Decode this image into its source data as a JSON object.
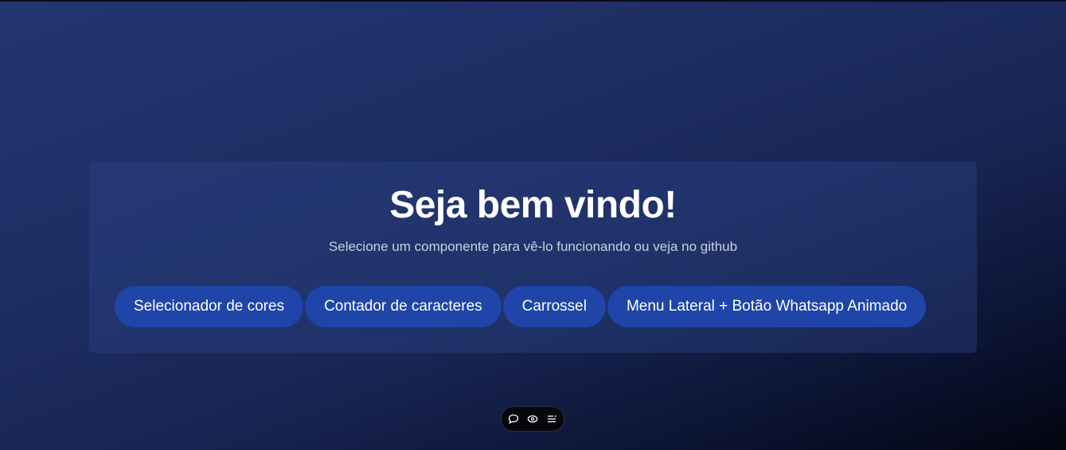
{
  "hero": {
    "title": "Seja bem vindo!",
    "subtitle": "Selecione um componente para vê-lo funcionando ou veja no github"
  },
  "components": [
    {
      "label": "Selecionador de cores"
    },
    {
      "label": "Contador de caracteres"
    },
    {
      "label": "Carrossel"
    },
    {
      "label": "Menu Lateral + Botão Whatsapp Animado"
    }
  ],
  "toolbar": {
    "icons": [
      "comment-icon",
      "eye-icon",
      "menu-icon"
    ]
  },
  "colors": {
    "button_bg": "#1f45a8",
    "toolbar_bg": "#05070d",
    "text": "#ffffff",
    "subtitle": "#c9d0e3"
  }
}
